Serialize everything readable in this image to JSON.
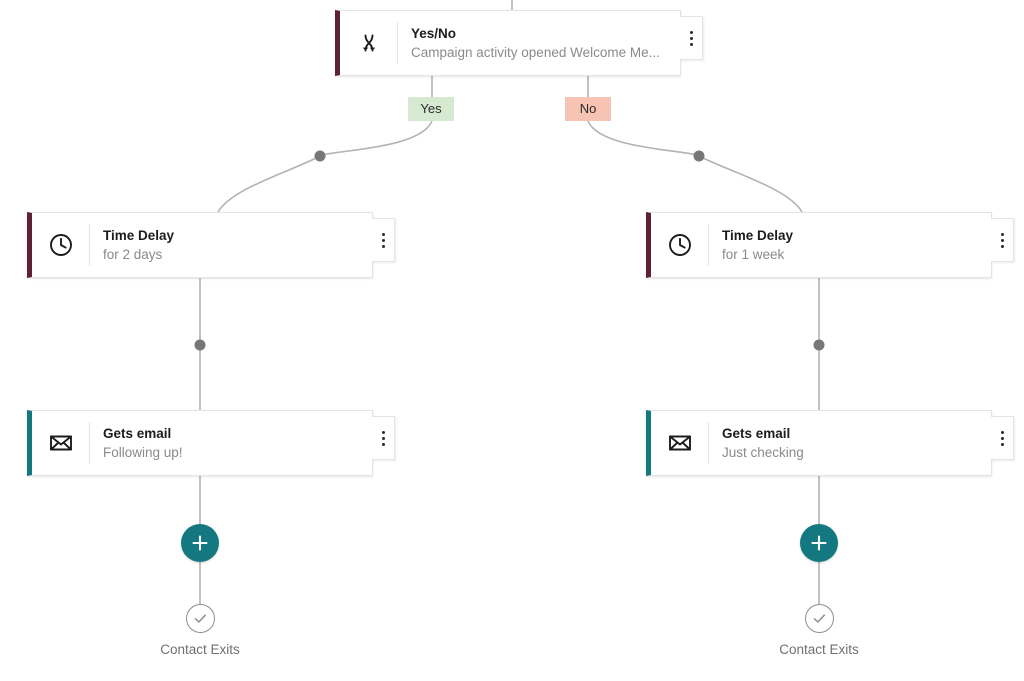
{
  "canvas": {
    "background": "#ffffff",
    "edge_color": "#b3b3b3",
    "edge_dot_color": "#777777"
  },
  "colors": {
    "accent_teal": "#13787f",
    "accent_maroon": "#5e2233",
    "yes_badge_bg": "#d5ead1",
    "yes_badge_text": "#2b2b2b",
    "no_badge_bg": "#f7c4b3",
    "no_badge_text": "#2b2b2b",
    "card_border": "#e4e4e4",
    "title_text": "#1c1c1c",
    "subtitle_text": "#8a8a8a",
    "exit_text": "#6f6f6f"
  },
  "nodes": {
    "condition": {
      "title": "Yes/No",
      "subtitle": "Campaign activity opened Welcome Me...",
      "icon": "branch-split-icon",
      "accent": "#5e2233"
    },
    "delay_left": {
      "title": "Time Delay",
      "subtitle": "for 2 days",
      "icon": "clock-icon",
      "accent": "#5e2233"
    },
    "delay_right": {
      "title": "Time Delay",
      "subtitle": "for 1 week",
      "icon": "clock-icon",
      "accent": "#5e2233"
    },
    "email_left": {
      "title": "Gets email",
      "subtitle": "Following up!",
      "icon": "envelope-icon",
      "accent": "#13787f"
    },
    "email_right": {
      "title": "Gets email",
      "subtitle": "Just checking",
      "icon": "envelope-icon",
      "accent": "#13787f"
    }
  },
  "branches": {
    "yes_label": "Yes",
    "no_label": "No"
  },
  "add_buttons": {
    "left_label": "+",
    "right_label": "+"
  },
  "exits": {
    "left_label": "Contact Exits",
    "right_label": "Contact Exits"
  }
}
